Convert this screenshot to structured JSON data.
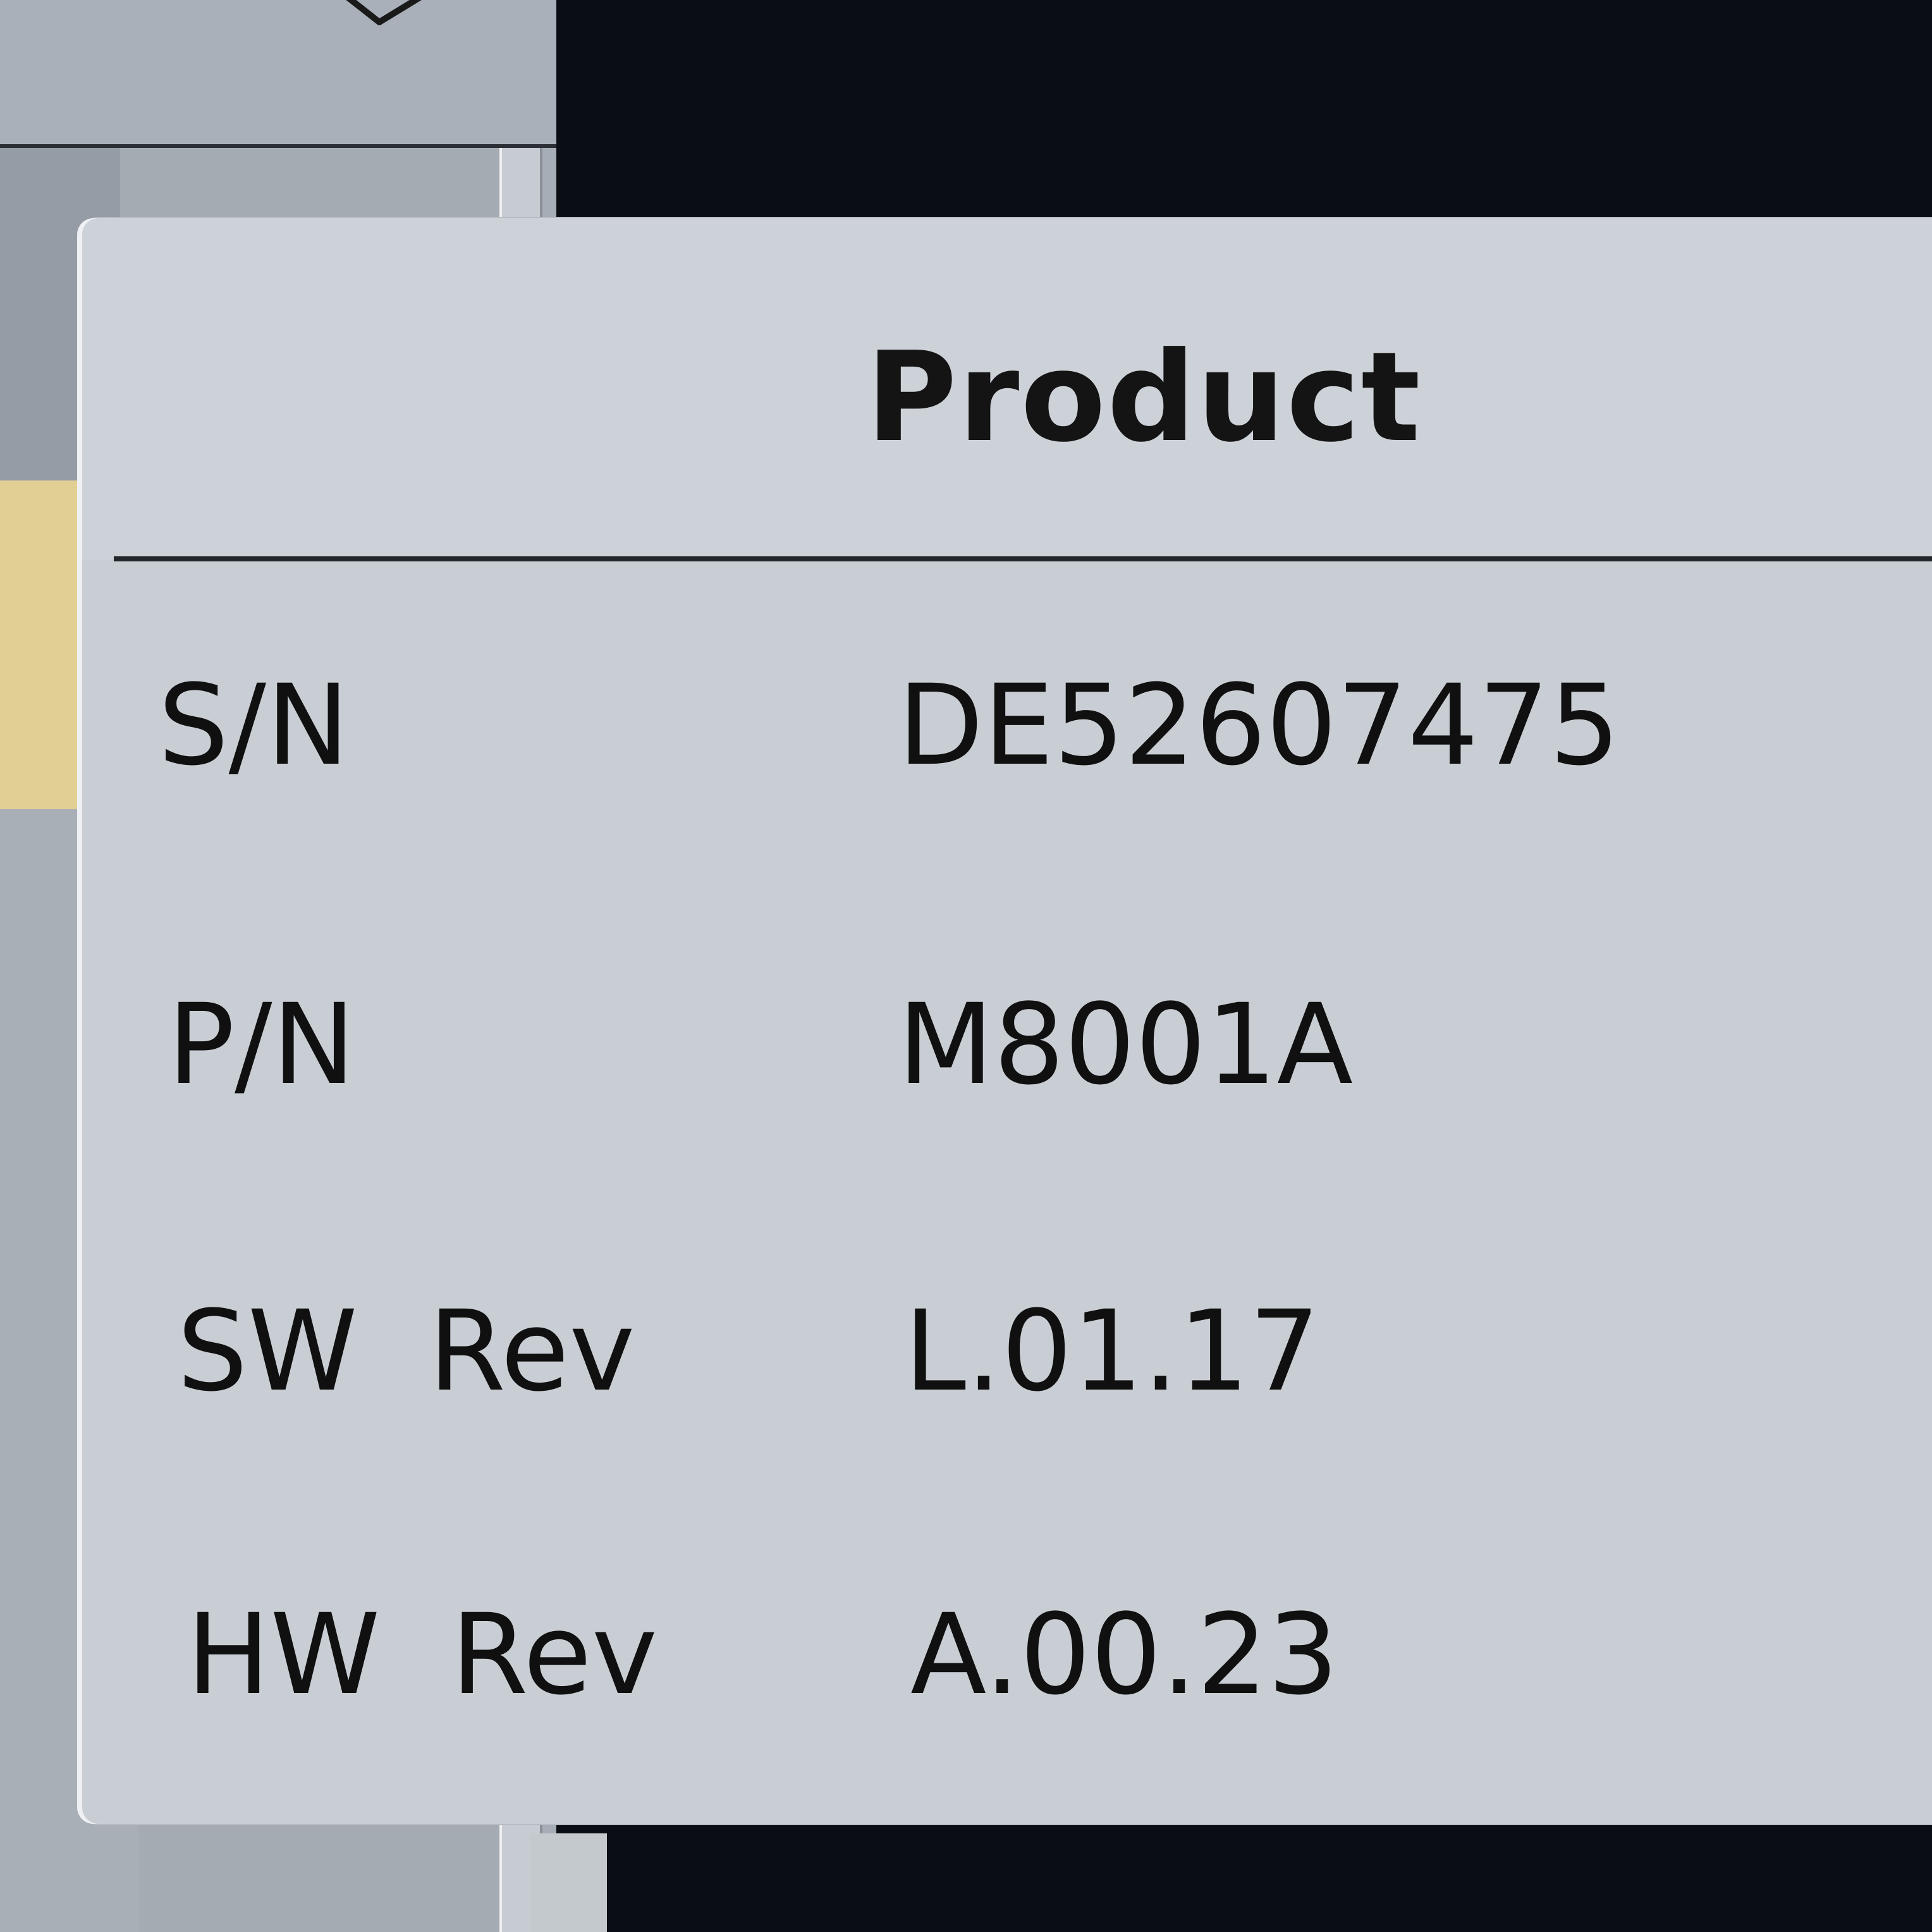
{
  "background_window": {
    "close_icon": "close-icon"
  },
  "product_dialog": {
    "title": "Product",
    "rows": [
      {
        "label": "S/N",
        "value": "DE52607475"
      },
      {
        "label": "P/N",
        "value": "M8001A"
      },
      {
        "label": "SW  Rev",
        "value": "L.01.17"
      },
      {
        "label": "HW  Rev",
        "value": "A.00.23"
      }
    ]
  },
  "colors": {
    "dialog_background": "#c9ced4",
    "screen_background": "#0b0d14",
    "highlight_row": "#e2cf94",
    "text": "#101010"
  }
}
